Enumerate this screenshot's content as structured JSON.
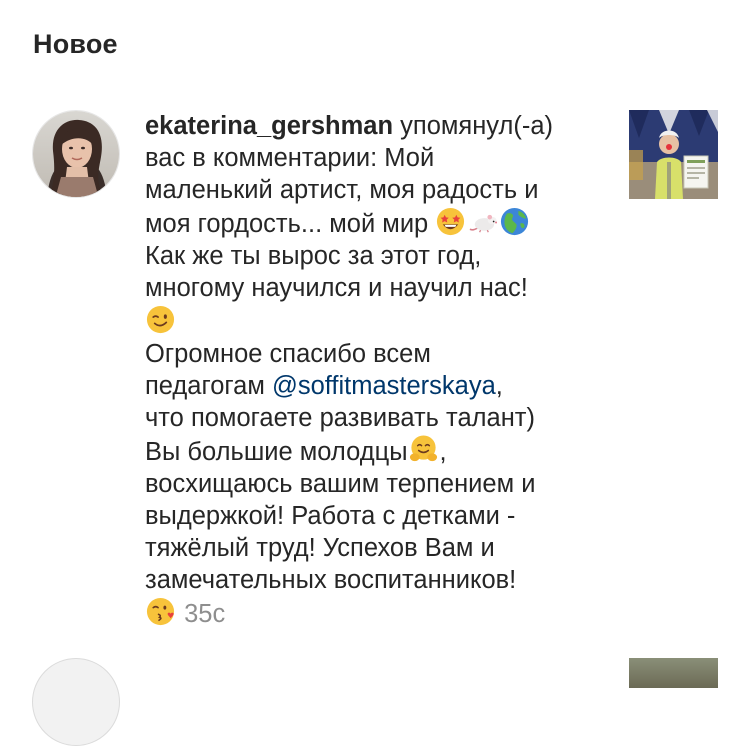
{
  "header": {
    "title": "Новое"
  },
  "notification": {
    "username": "ekaterina_gershman",
    "lines": {
      "l1_rest": " упомянул(-а)",
      "l2": "вас в комментарии: Мой",
      "l3": "маленький артист, моя радость и",
      "l4": "моя гордость... мой мир",
      "l5": "Как же ты вырос за этот год,",
      "l6": "многому научился и научил нас!",
      "l8": "Огромное спасибо всем",
      "l9_pre": "педагогам ",
      "mention": "@soffitmasterskaya",
      "l9_post": ",",
      "l10": "что помогаете развивать талант)",
      "l11": "Вы большие молодцы",
      "l11_post": ",",
      "l12": "восхищаюсь вашим терпением и",
      "l13": "выдержкой! Работа с детками -",
      "l14": "тяжёлый труд! Успехов Вам и",
      "l15": "замечательных воспитанников!"
    },
    "time": "35с",
    "emoji_icons": [
      "star-struck-emoji-icon",
      "rat-emoji-icon",
      "globe-emoji-icon",
      "winking-face-emoji-icon",
      "hugging-face-emoji-icon",
      "kissing-face-emoji-icon"
    ]
  },
  "colors": {
    "text": "#262626",
    "mention": "#00376b",
    "secondary": "#8e8e8e",
    "background": "#ffffff"
  }
}
